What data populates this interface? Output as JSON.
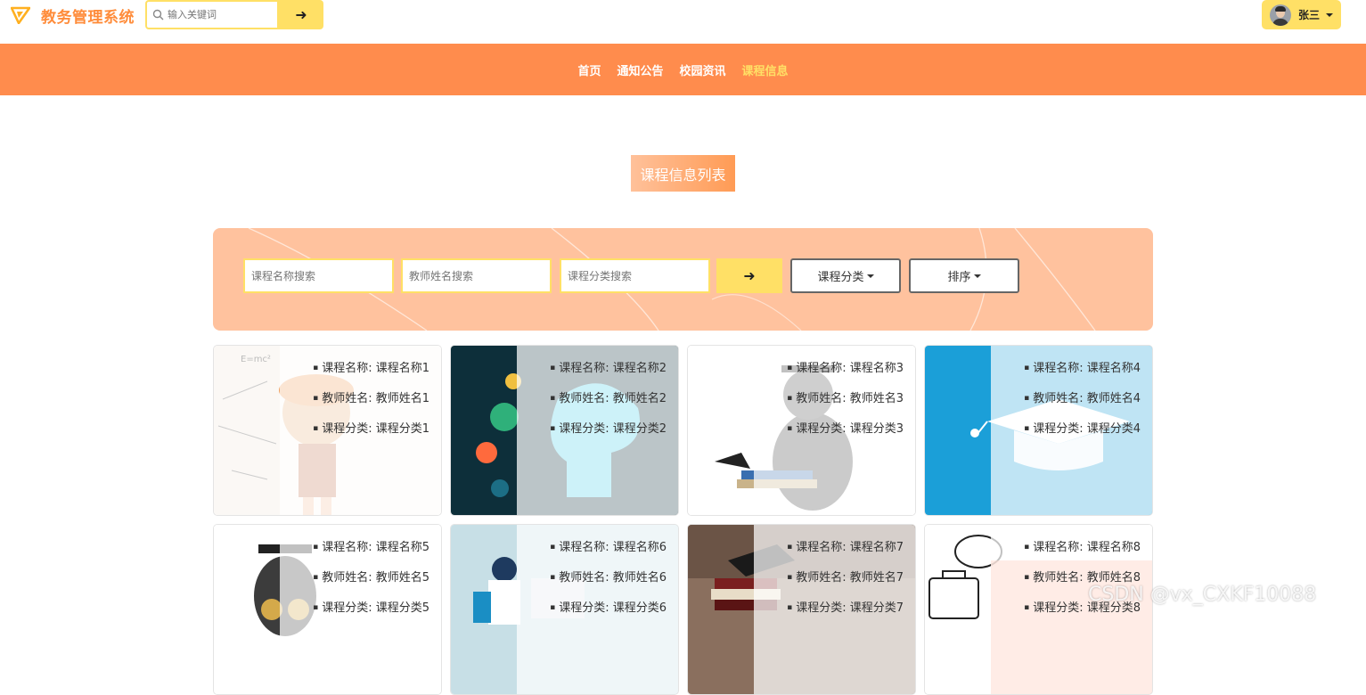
{
  "header": {
    "brand": "教务管理系统",
    "search_placeholder": "输入关键词",
    "search_button": "➜",
    "user_name": "张三"
  },
  "nav": {
    "items": [
      {
        "label": "首页",
        "active": false
      },
      {
        "label": "通知公告",
        "active": false
      },
      {
        "label": "校园资讯",
        "active": false
      },
      {
        "label": "课程信息",
        "active": true
      }
    ]
  },
  "main": {
    "title": "课程信息列表",
    "filters": {
      "course_name_placeholder": "课程名称搜索",
      "teacher_name_placeholder": "教师姓名搜索",
      "category_placeholder": "课程分类搜索",
      "go_button": "➜",
      "category_dropdown": "课程分类",
      "sort_dropdown": "排序"
    },
    "cards": [
      {
        "name": "课程名称: 课程名称1",
        "teacher": "教师姓名: 教师姓名1",
        "category": "课程分类: 课程分类1"
      },
      {
        "name": "课程名称: 课程名称2",
        "teacher": "教师姓名: 教师姓名2",
        "category": "课程分类: 课程分类2"
      },
      {
        "name": "课程名称: 课程名称3",
        "teacher": "教师姓名: 教师姓名3",
        "category": "课程分类: 课程分类3"
      },
      {
        "name": "课程名称: 课程名称4",
        "teacher": "教师姓名: 教师姓名4",
        "category": "课程分类: 课程分类4"
      },
      {
        "name": "课程名称: 课程名称5",
        "teacher": "教师姓名: 教师姓名5",
        "category": "课程分类: 课程分类5"
      },
      {
        "name": "课程名称: 课程名称6",
        "teacher": "教师姓名: 教师姓名6",
        "category": "课程分类: 课程分类6"
      },
      {
        "name": "课程名称: 课程名称7",
        "teacher": "教师姓名: 教师姓名7",
        "category": "课程分类: 课程分类7"
      },
      {
        "name": "课程名称: 课程名称8",
        "teacher": "教师姓名: 教师姓名8",
        "category": "课程分类: 课程分类8"
      }
    ]
  },
  "watermark": "CSDN @vx_CXKF10088",
  "colors": {
    "accent_orange": "#ff8c4d",
    "accent_yellow": "#ffe066",
    "panel_peach": "#ffc29e"
  }
}
